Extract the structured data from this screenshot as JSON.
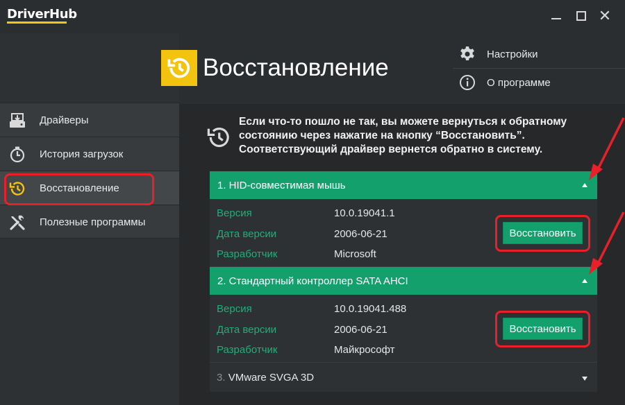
{
  "app": {
    "logo": "DriverHub"
  },
  "window_controls": {
    "minimize": "minimize",
    "maximize": "maximize",
    "close": "✕"
  },
  "top_menu": [
    {
      "label": "Настройки",
      "icon": "gear-icon"
    },
    {
      "label": "О программе",
      "icon": "info-icon"
    }
  ],
  "header": {
    "title": "Восстановление",
    "icon": "restore-history-icon"
  },
  "sidebar": {
    "items": [
      {
        "label": "Драйверы",
        "icon": "drive-icon"
      },
      {
        "label": "История загрузок",
        "icon": "stopwatch-icon"
      },
      {
        "label": "Восстановление",
        "icon": "restore-history-icon",
        "active": true
      },
      {
        "label": "Полезные программы",
        "icon": "tools-icon"
      }
    ]
  },
  "info": {
    "text_line1": "Если что-то пошло не так, вы можете вернуться к обратному",
    "text_line2": "состоянию через нажатие на кнопку “Восстановить”.",
    "text_line3": "Соответствующий драйвер вернется обратно в систему."
  },
  "drivers": [
    {
      "title": "1. HID-совместимая мышь",
      "version_label": "Версия",
      "version": "10.0.19041.1",
      "date_label": "Дата версии",
      "date": "2006-06-21",
      "dev_label": "Разработчик",
      "dev": "Microsoft",
      "button": "Восстановить"
    },
    {
      "title": "2. Стандартный контроллер SATA AHCI",
      "version_label": "Версия",
      "version": "10.0.19041.488",
      "date_label": "Дата версии",
      "date": "2006-06-21",
      "dev_label": "Разработчик",
      "dev": "Майкрософт",
      "button": "Восстановить"
    },
    {
      "num": "3.",
      "name": "VMware SVGA 3D"
    }
  ],
  "colors": {
    "accent_green": "#14a06d",
    "label_green": "#1fae78",
    "yellow": "#f2c30f",
    "highlight_red": "#e8202a"
  }
}
